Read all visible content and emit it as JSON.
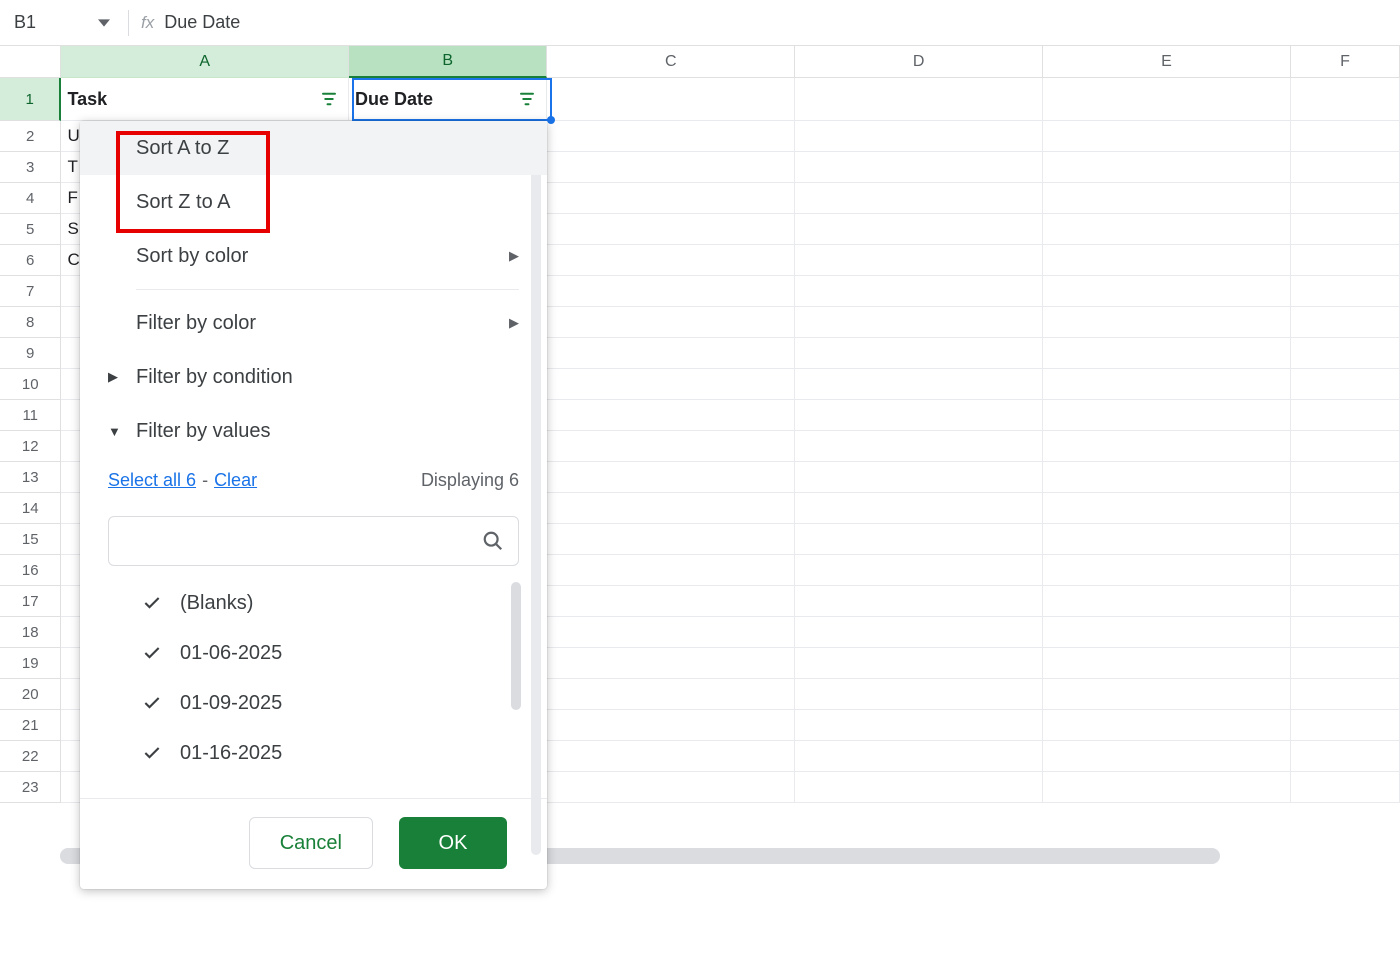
{
  "nameBox": "B1",
  "fxLabel": "fx",
  "formula": "Due Date",
  "columns": [
    "A",
    "B",
    "C",
    "D",
    "E",
    "F"
  ],
  "headerRow": {
    "A": "Task",
    "B": "Due Date"
  },
  "peekCells": {
    "r2": "U",
    "r3": "T",
    "r4": "F",
    "r5": "S",
    "r6": "C"
  },
  "rowCount": 23,
  "filter": {
    "sortAZ": "Sort A to Z",
    "sortZA": "Sort Z to A",
    "sortColor": "Sort by color",
    "filterColor": "Filter by color",
    "filterCondition": "Filter by condition",
    "filterValues": "Filter by values",
    "selectAll": "Select all 6",
    "clear": "Clear",
    "displaying": "Displaying 6",
    "values": [
      "(Blanks)",
      "01-06-2025",
      "01-09-2025",
      "01-16-2025"
    ],
    "cancel": "Cancel",
    "ok": "OK"
  }
}
